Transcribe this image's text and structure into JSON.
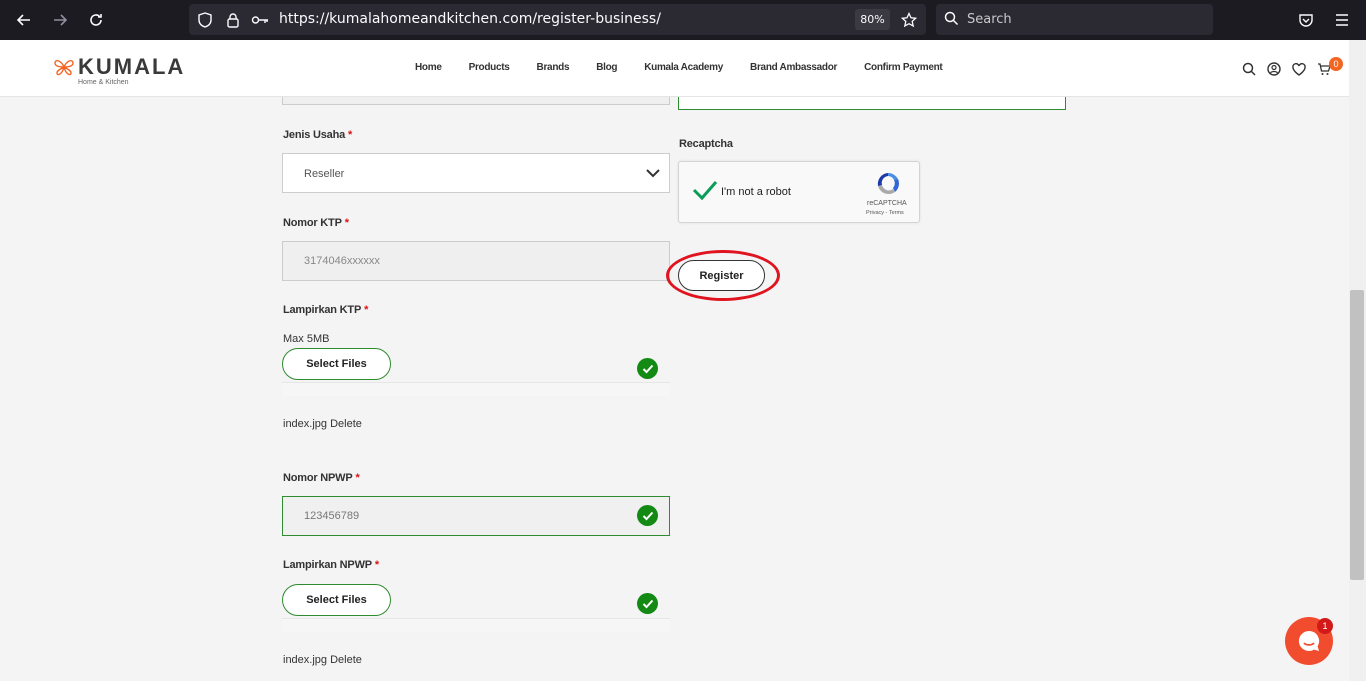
{
  "browser": {
    "url": "https://kumalahomeandkitchen.com/register-business/",
    "zoom": "80%",
    "search_placeholder": "Search"
  },
  "site": {
    "logo": "KUMALA",
    "logo_sub": "Home & Kitchen",
    "nav": [
      "Home",
      "Products",
      "Brands",
      "Blog",
      "Kumala Academy",
      "Brand Ambassador",
      "Confirm Payment"
    ],
    "cart_count": "0",
    "accent": "#f26522"
  },
  "form": {
    "jenis_label": "Jenis Usaha",
    "required_mark": "*",
    "jenis_value": "Reseller",
    "ktp_label": "Nomor KTP",
    "ktp_placeholder": "3174046xxxxxx",
    "lampiran_ktp_label": "Lampirkan KTP",
    "max_size": "Max 5MB",
    "select_files": "Select Files",
    "ktp_file": "index.jpg Delete",
    "npwp_label": "Nomor NPWP",
    "npwp_value": "123456789",
    "lampiran_npwp_label": "Lampirkan NPWP",
    "npwp_file": "index.jpg Delete",
    "recaptcha_label": "Recaptcha",
    "recaptcha_text": "I'm not a robot",
    "recaptcha_brand": "reCAPTCHA",
    "recaptcha_links": "Privacy - Terms",
    "register": "Register"
  },
  "chat": {
    "badge": "1"
  }
}
